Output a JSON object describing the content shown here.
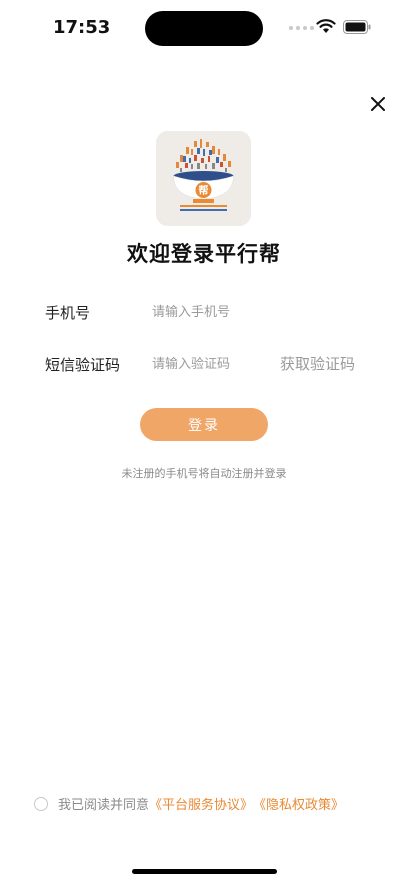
{
  "status_bar": {
    "time": "17:53"
  },
  "app": {
    "title": "欢迎登录平行帮",
    "logo_text": "帮"
  },
  "form": {
    "phone_label": "手机号",
    "phone_placeholder": "请输入手机号",
    "code_label": "短信验证码",
    "code_placeholder": "请输入验证码",
    "get_code_label": "获取验证码",
    "login_label": "登录",
    "hint": "未注册的手机号将自动注册并登录"
  },
  "agreement": {
    "prefix": "我已阅读并同意",
    "platform_link": "《平台服务协议》",
    "privacy_link": "《隐私权政策》"
  },
  "colors": {
    "accent": "#efa667",
    "link": "#e98a34"
  }
}
